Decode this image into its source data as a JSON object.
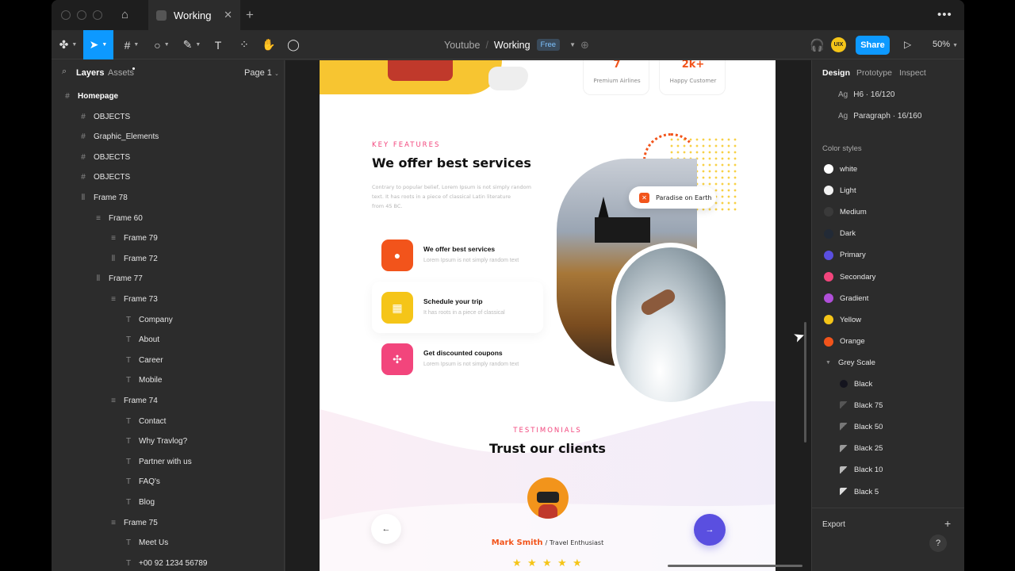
{
  "titlebar": {
    "tab_title": "Working",
    "close": "✕",
    "new_tab": "+",
    "more": "•••"
  },
  "toolbar": {
    "main_menu_icon": "figma-icon",
    "project": "Youtube",
    "separator": "/",
    "file": "Working",
    "plan_badge": "Free",
    "share_label": "Share",
    "zoom": "50%",
    "avatar_text": "UIX"
  },
  "left_panel": {
    "tabs": {
      "layers": "Layers",
      "assets": "Assets"
    },
    "page_select": "Page 1",
    "layers": [
      {
        "label": "Homepage",
        "icon": "frame-icon",
        "indent": 0
      },
      {
        "label": "OBJECTS",
        "icon": "frame-icon",
        "indent": 1
      },
      {
        "label": "Graphic_Elements",
        "icon": "frame-icon",
        "indent": 1
      },
      {
        "label": "OBJECTS",
        "icon": "frame-icon",
        "indent": 1
      },
      {
        "label": "OBJECTS",
        "icon": "frame-icon",
        "indent": 1
      },
      {
        "label": "Frame 78",
        "icon": "autolayout-h-icon",
        "indent": 1
      },
      {
        "label": "Frame 60",
        "icon": "autolayout-v-icon",
        "indent": 2
      },
      {
        "label": "Frame 79",
        "icon": "autolayout-v-icon",
        "indent": 3
      },
      {
        "label": "Frame 72",
        "icon": "autolayout-h-icon",
        "indent": 3
      },
      {
        "label": "Frame 77",
        "icon": "autolayout-h-icon",
        "indent": 2
      },
      {
        "label": "Frame 73",
        "icon": "autolayout-v-icon",
        "indent": 3
      },
      {
        "label": "Company",
        "icon": "text-icon",
        "indent": 4
      },
      {
        "label": "About",
        "icon": "text-icon",
        "indent": 4
      },
      {
        "label": "Career",
        "icon": "text-icon",
        "indent": 4
      },
      {
        "label": "Mobile",
        "icon": "text-icon",
        "indent": 4
      },
      {
        "label": "Frame 74",
        "icon": "autolayout-v-icon",
        "indent": 3
      },
      {
        "label": "Contact",
        "icon": "text-icon",
        "indent": 4
      },
      {
        "label": "Why Travlog?",
        "icon": "text-icon",
        "indent": 4
      },
      {
        "label": "Partner with us",
        "icon": "text-icon",
        "indent": 4
      },
      {
        "label": "FAQ's",
        "icon": "text-icon",
        "indent": 4
      },
      {
        "label": "Blog",
        "icon": "text-icon",
        "indent": 4
      },
      {
        "label": "Frame 75",
        "icon": "autolayout-v-icon",
        "indent": 3
      },
      {
        "label": "Meet Us",
        "icon": "text-icon",
        "indent": 4
      },
      {
        "label": "+00 92 1234 56789",
        "icon": "text-icon",
        "indent": 4
      }
    ]
  },
  "right_panel": {
    "tabs": {
      "design": "Design",
      "prototype": "Prototype",
      "inspect": "Inspect"
    },
    "text_styles": [
      {
        "ag": "Ag",
        "label": "H6 · 16/120"
      },
      {
        "ag": "Ag",
        "label": "Paragraph · 16/160"
      }
    ],
    "color_styles_title": "Color styles",
    "color_styles": [
      {
        "label": "white",
        "color": "#ffffff"
      },
      {
        "label": "Light",
        "color": "#f2f2f2"
      },
      {
        "label": "Medium",
        "color": "#3a3a3a"
      },
      {
        "label": "Dark",
        "color": "#222a36"
      },
      {
        "label": "Primary",
        "color": "#5a4fe0"
      },
      {
        "label": "Secondary",
        "color": "#f2457c"
      },
      {
        "label": "Gradient",
        "color": "#b04fd8"
      },
      {
        "label": "Yellow",
        "color": "#f5c518"
      },
      {
        "label": "Orange",
        "color": "#f2541b"
      }
    ],
    "grey_scale_label": "Grey Scale",
    "grey_scale": [
      {
        "label": "Black",
        "color": "#14141e"
      },
      {
        "label": "Black 75",
        "color": "#555555"
      },
      {
        "label": "Black 50",
        "color": "#777777"
      },
      {
        "label": "Black 25",
        "color": "#999999"
      },
      {
        "label": "Black 10",
        "color": "#bbbbbb"
      },
      {
        "label": "Black 5",
        "color": "#dddddd"
      }
    ],
    "export_label": "Export",
    "help": "?"
  },
  "design_frame": {
    "stats": [
      {
        "value": "7",
        "label": "Premium Airlines"
      },
      {
        "value": "2k+",
        "label": "Happy Customer"
      }
    ],
    "kicker": "KEY FEATURES",
    "heading": "We offer best services",
    "paragraph_lines": [
      "Contrary to popular belief, Lorem Ipsum is not simply random",
      "text. It has roots in a piece of classical Latin literature",
      "from 45 BC."
    ],
    "features": [
      {
        "title": "We offer best services",
        "sub": "Lorem Ipsum is not simply random text",
        "color": "#f2541b"
      },
      {
        "title": "Schedule your trip",
        "sub": "It has roots in a piece of classical",
        "color": "#f5c518"
      },
      {
        "title": "Get discounted coupons",
        "sub": "Lorem Ipsum is not simply random text",
        "color": "#f2457c"
      }
    ],
    "badge": "Paradise on Earth",
    "testimonials_kicker": "TESTIMONIALS",
    "testimonials_heading": "Trust our clients",
    "client_name": "Mark Smith",
    "client_role": "/ Travel Enthusiast",
    "prev": "←",
    "next": "→"
  }
}
